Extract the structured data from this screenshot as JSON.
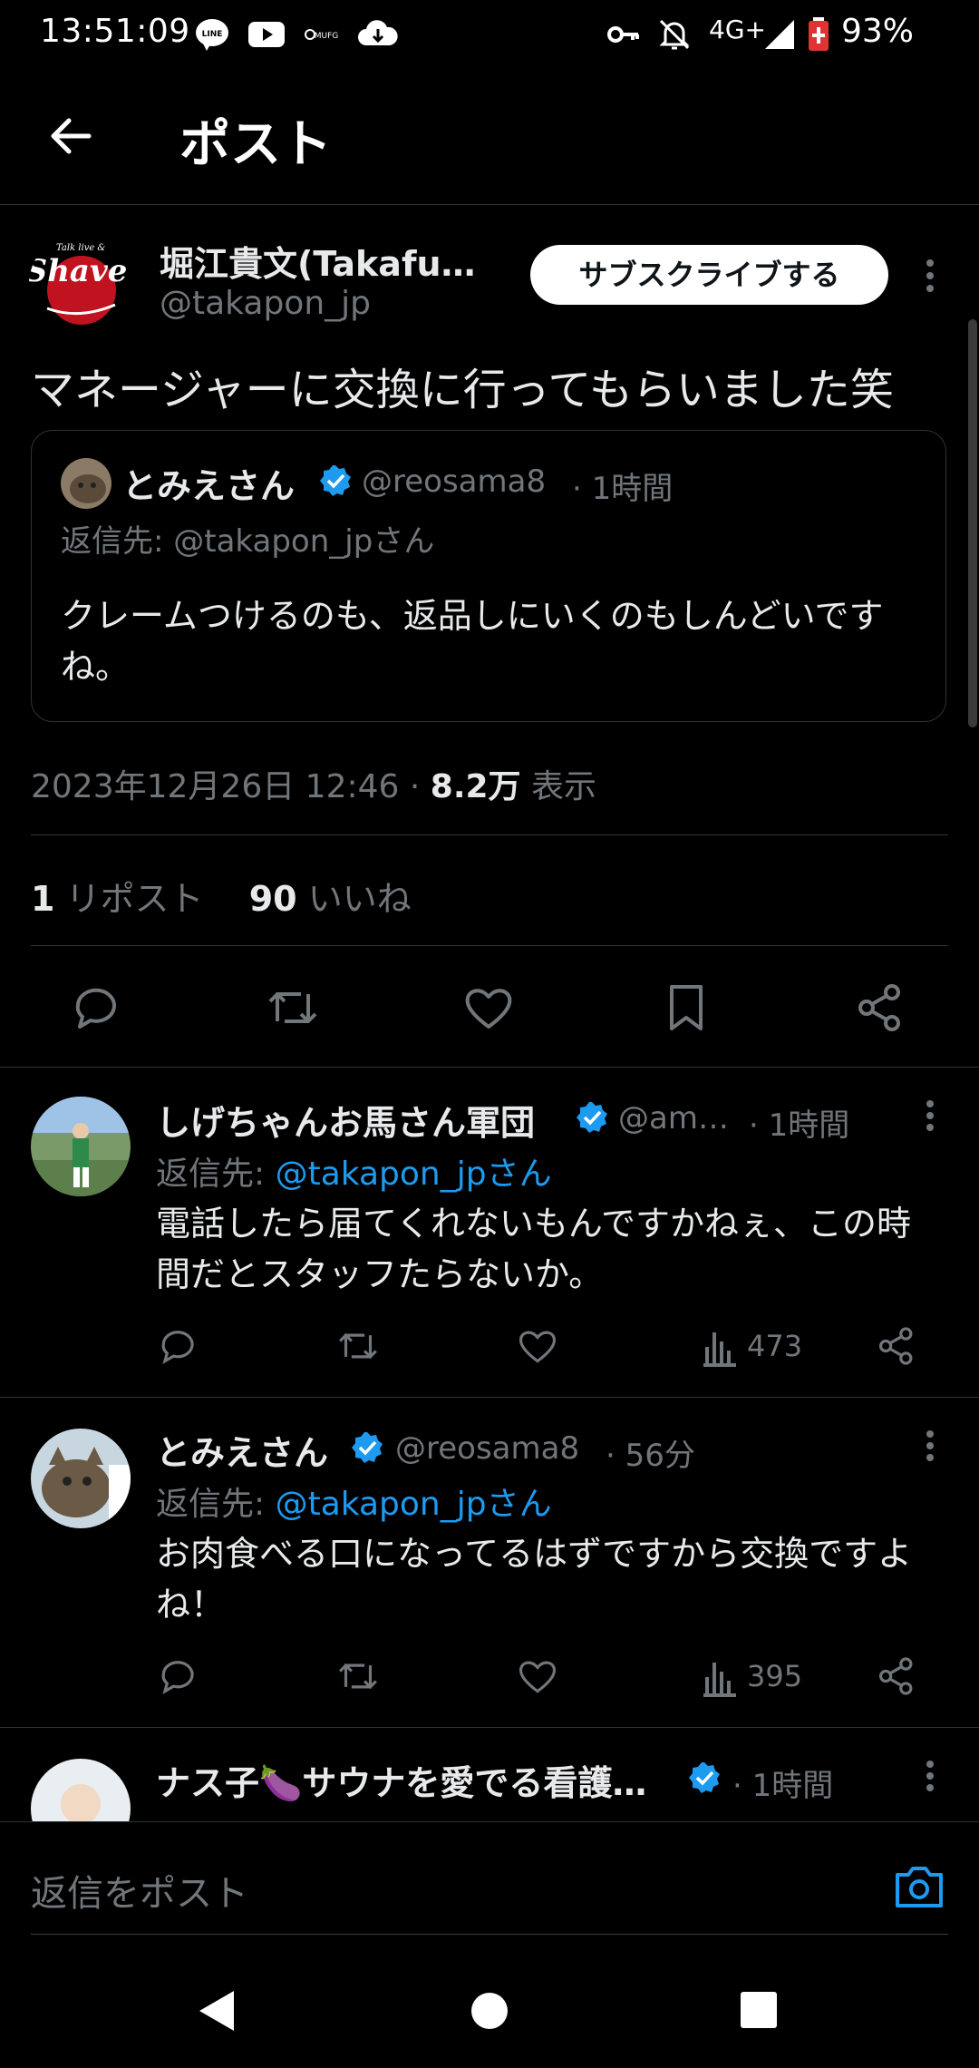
{
  "status_bar": {
    "time": "13:51:09",
    "battery": "93%",
    "network": "4G+",
    "icons": [
      "line-icon",
      "youtube-icon",
      "mufg-icon",
      "cloud-download-icon",
      "key-icon",
      "mute-icon",
      "signal-icon",
      "battery-icon"
    ]
  },
  "header": {
    "title": "ポスト"
  },
  "post": {
    "author_name": "堀江貴文(Takafu…",
    "author_handle": "@takapon_jp",
    "subscribe_label": "サブスクライブする",
    "text": "マネージャーに交換に行ってもらいました笑",
    "quote": {
      "name": "とみえさん",
      "handle": "@reosama8",
      "time": "· 1時間",
      "reply_to": "返信先: @takapon_jpさん",
      "text": "クレームつけるのも、返品しにいくのもしんどいですね。"
    },
    "timestamp": "2023年12月26日 12:46 · ",
    "views": "8.2万",
    "views_label": " 表示",
    "reposts": "1",
    "reposts_label": " リポスト",
    "likes": "90",
    "likes_label": " いいね"
  },
  "replies": [
    {
      "name": "しげちゃんお馬さん軍団",
      "handle": "@am…",
      "time": "· 1時間",
      "reply_prefix": "返信先: ",
      "reply_to": "@takapon_jpさん",
      "text": "電話したら届てくれないもんですかねぇ、この時間だとスタッフたらないか。",
      "views": "473"
    },
    {
      "name": "とみえさん",
      "handle": "@reosama8",
      "time": "· 56分",
      "reply_prefix": "返信先: ",
      "reply_to": "@takapon_jpさん",
      "text": "お肉食べる口になってるはずですから交換ですよね！",
      "views": "395"
    },
    {
      "name": "ナス子🍆サウナを愛でる看護…",
      "time": "· 1時間"
    }
  ],
  "composer": {
    "placeholder": "返信をポスト"
  },
  "colors": {
    "accent": "#1d9bf0",
    "background": "#000000",
    "muted": "#71767b",
    "text": "#e7e9ea"
  }
}
